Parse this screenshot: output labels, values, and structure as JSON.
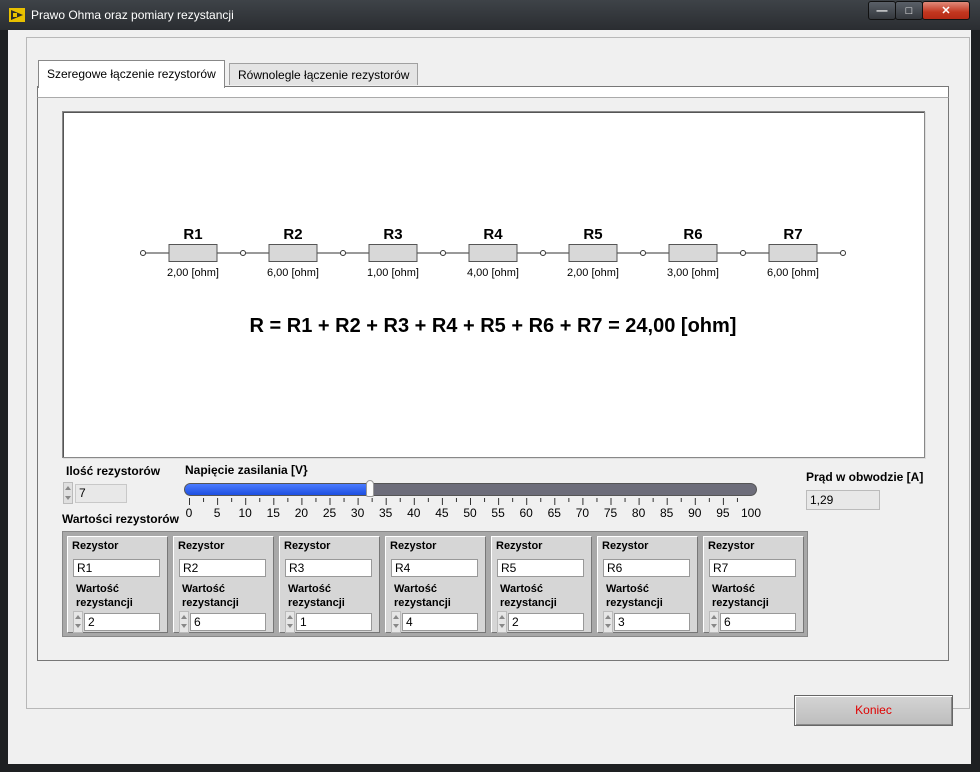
{
  "window": {
    "title": "Prawo Ohma oraz pomiary rezystancji"
  },
  "tabs": [
    {
      "label": "Szeregowe łączenie rezystorów",
      "active": true
    },
    {
      "label": "Równolegle łączenie rezystorów",
      "active": false
    }
  ],
  "circuit": {
    "resistors": [
      {
        "name": "R1",
        "value": "2,00 [ohm]"
      },
      {
        "name": "R2",
        "value": "6,00 [ohm]"
      },
      {
        "name": "R3",
        "value": "1,00 [ohm]"
      },
      {
        "name": "R4",
        "value": "4,00 [ohm]"
      },
      {
        "name": "R5",
        "value": "2,00 [ohm]"
      },
      {
        "name": "R6",
        "value": "3,00 [ohm]"
      },
      {
        "name": "R7",
        "value": "6,00 [ohm]"
      }
    ],
    "formula": "R = R1 + R2 + R3 + R4 + R5 + R6 + R7 = 24,00 [ohm]"
  },
  "controls": {
    "count_label": "Ilość rezystorów",
    "count_value": "7",
    "voltage_label": "Napięcie zasilania [V}",
    "voltage_value": 32,
    "voltage_min": 0,
    "voltage_max": 100,
    "voltage_ticks": [
      "0",
      "5",
      "10",
      "15",
      "20",
      "25",
      "30",
      "35",
      "40",
      "45",
      "50",
      "55",
      "60",
      "65",
      "70",
      "75",
      "80",
      "85",
      "90",
      "95",
      "100"
    ],
    "current_label": "Prąd w obwodzie [A]",
    "current_value": "1,29",
    "values_label": "Wartości rezystorów"
  },
  "resistor_cells": {
    "header": "Rezystor",
    "value_label_1": "Wartość",
    "value_label_2": "rezystancji",
    "items": [
      {
        "name": "R1",
        "value": "2"
      },
      {
        "name": "R2",
        "value": "6"
      },
      {
        "name": "R3",
        "value": "1"
      },
      {
        "name": "R4",
        "value": "4"
      },
      {
        "name": "R5",
        "value": "2"
      },
      {
        "name": "R6",
        "value": "3"
      },
      {
        "name": "R7",
        "value": "6"
      }
    ]
  },
  "buttons": {
    "end_label": "Koniec"
  },
  "colors": {
    "accent": "#1d4fe0",
    "end_text": "#e00000"
  }
}
